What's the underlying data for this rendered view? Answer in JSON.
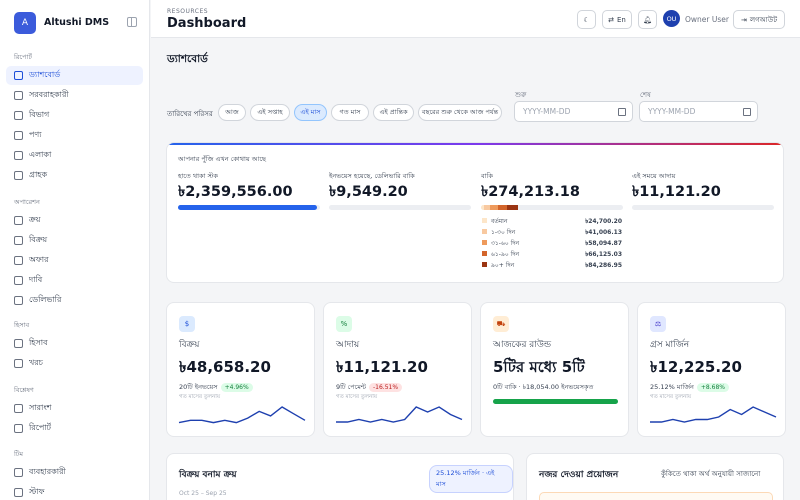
{
  "app": {
    "logo_letter": "A",
    "name": "Altushi DMS"
  },
  "sidebar": {
    "sec1": "রিপোর্ট",
    "sec2": "অপারেশন",
    "sec3": "হিসাব",
    "sec4": "বিশ্লেষণ",
    "sec5": "টিম",
    "items1": [
      "ড্যাশবোর্ড",
      "সরবরাহকারী",
      "বিভাগ",
      "পণ্য",
      "এলাকা",
      "গ্রাহক"
    ],
    "items2": [
      "ক্রয়",
      "বিক্রয়",
      "অফার",
      "দাবি",
      "ডেলিভারি"
    ],
    "items3": [
      "হিসাব",
      "খরচ"
    ],
    "items4": [
      "সারাংশ",
      "রিপোর্ট"
    ],
    "items5": [
      "ব্যবহারকারী",
      "স্টাফ"
    ]
  },
  "header": {
    "breadcrumb": "RESOURCES",
    "title": "Dashboard",
    "lang": "En",
    "avatar": "OU",
    "user": "Owner User",
    "logout": "লগআউট"
  },
  "page": {
    "heading": "ড্যাশবোর্ড"
  },
  "filters": {
    "label": "তারিখের পরিসর",
    "chips": [
      "আজ",
      "এই সপ্তাহ",
      "এই মাস",
      "গত মাস",
      "এই প্রান্তিক",
      "বছরের শুরু থেকে আজ পর্যন্ত"
    ],
    "active": "এই মাস",
    "from_label": "শুরু",
    "to_label": "শেষ",
    "placeholder": "YYYY-MM-DD"
  },
  "money": {
    "title": "আপনার পুঁজি এখন কোথায় আছে",
    "c1": {
      "label": "হাতে থাকা স্টক",
      "value": "৳2,359,556.00",
      "fill": 0.98
    },
    "c2": {
      "label": "ইনভয়েস হয়েছে, ডেলিভারি বাকি",
      "value": "৳9,549.20"
    },
    "c3": {
      "label": "বাকি",
      "value": "৳274,213.18"
    },
    "c4": {
      "label": "এই সময়ে আদায়",
      "value": "৳11,121.20"
    },
    "aging": [
      {
        "label": "বর্তমান",
        "value": "৳24,700.20",
        "color": "#fde6c9"
      },
      {
        "label": "১-৩০ দিন",
        "value": "৳41,006.13",
        "color": "#f8c9a0"
      },
      {
        "label": "৩১-৬০ দিন",
        "value": "৳58,094.87",
        "color": "#ee9a5c"
      },
      {
        "label": "৬১-৯০ দিন",
        "value": "৳66,125.03",
        "color": "#d3652b"
      },
      {
        "label": "৯০+ দিন",
        "value": "৳84,286.95",
        "color": "#9a3412"
      }
    ]
  },
  "kpis": [
    {
      "icon": "$",
      "label": "বিক্রয়",
      "value": "৳48,658.20",
      "sub": "20টি ইনভয়েস",
      "badge": "+4.96%",
      "badge_type": "up",
      "note": "গত মাসের তুলনায়",
      "spark": [
        2,
        3,
        3,
        2,
        3,
        2,
        4,
        7,
        5,
        9,
        6,
        3
      ]
    },
    {
      "icon": "%",
      "label": "আদায়",
      "value": "৳11,121.20",
      "sub": "9টি পেমেন্ট",
      "badge": "-16.51%",
      "badge_type": "down",
      "note": "গত মাসের তুলনায়",
      "spark": [
        2,
        2,
        3,
        2,
        3,
        2,
        3,
        8,
        6,
        8,
        5,
        3
      ]
    },
    {
      "icon": "⛟",
      "label": "আজকের রাউন্ড",
      "value": "5টির মধ্যে 5টি",
      "sub": "0টি বাকি · ৳18,054.00 ইনভয়েসকৃত",
      "progress": 1
    },
    {
      "icon": "⚖",
      "label": "গ্রস মার্জিন",
      "value": "৳12,225.20",
      "sub": "25.12% মার্জিন",
      "badge": "+8.68%",
      "badge_type": "up",
      "note": "গত মাসের তুলনায়",
      "spark": [
        2,
        2,
        3,
        2,
        3,
        3,
        4,
        7,
        5,
        8,
        6,
        4
      ]
    }
  ],
  "bottom": {
    "left_title": "বিক্রয় বনাম ক্রয়",
    "left_pill": "25.12% মার্জিন · এই মাস",
    "left_range": "Oct 25 – Sep 25",
    "right_title": "নজর দেওয়া প্রয়োজন",
    "right_sub": "কুঁকিতে থাকা অর্থ অনুযায়ী সাজানো"
  },
  "colors": {
    "accent": "#2563eb",
    "spark": "#1e40af",
    "progress": "#16a34a"
  }
}
